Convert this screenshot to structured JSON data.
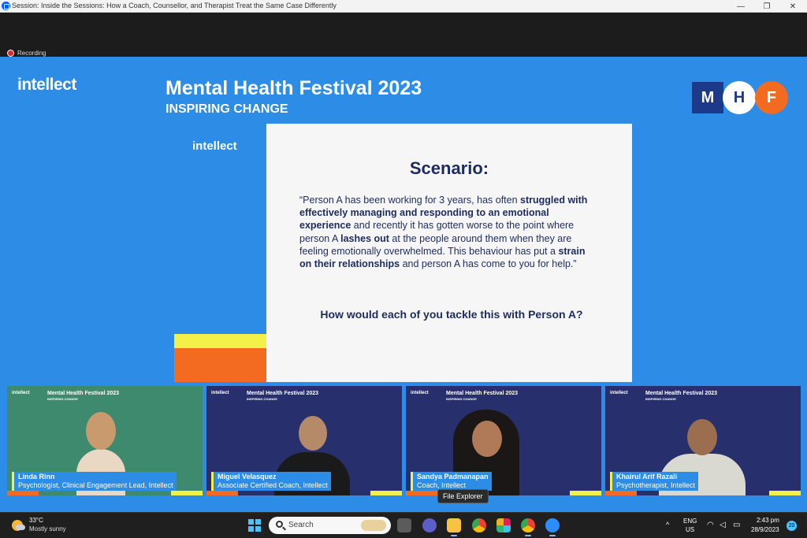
{
  "window": {
    "title": "Session: Inside the Sessions: How a Coach, Counsellor, and Therapist Treat the Same Case Differently",
    "minimize_glyph": "—",
    "restore_glyph": "❐",
    "close_glyph": "✕"
  },
  "recording": {
    "label": "Recording"
  },
  "header": {
    "logo": "intellect",
    "title": "Mental Health Festival 2023",
    "subtitle": "INSPIRING CHANGE",
    "badge": {
      "m": "M",
      "h": "H",
      "f": "F"
    }
  },
  "slide": {
    "logo": "intellect",
    "heading": "Scenario:",
    "body_parts": [
      "“Person A has been working for 3 years, has often ",
      "struggled with effectively managing and responding to an emotional experience",
      " and recently it has gotten worse to the point where person A ",
      "lashes out",
      " at the people around them when they are feeling emotionally overwhelmed. This behaviour has put a ",
      "strain on their relationships",
      " and person A has come to you for help.”"
    ],
    "question": "How would each of you tackle this with Person A?"
  },
  "participants": [
    {
      "name": "Linda Rinn",
      "role": "Psychologist, Clinical Engagement Lead, Intellect",
      "bg": "#3d8a6e"
    },
    {
      "name": "Miguel Velasquez",
      "role": "Associate Certified Coach, Intellect",
      "bg": "#27306d"
    },
    {
      "name": "Sandya Padmanapan",
      "role": "Coach, Intellect",
      "bg": "#27306d"
    },
    {
      "name": "Khairul Arif Razali",
      "role": "Psychotherapist, Intellect",
      "bg": "#27306d"
    }
  ],
  "tile_header": {
    "logo": "intellect",
    "title": "Mental Health Festival 2023",
    "subtitle": "INSPIRING CHANGE"
  },
  "tooltip": {
    "text": "File Explorer"
  },
  "taskbar": {
    "weather": {
      "temp": "33°C",
      "condition": "Mostly sunny"
    },
    "search_label": "Search",
    "apps": [
      "task-view",
      "teams",
      "file-explorer",
      "chrome",
      "slack",
      "chrome-profile",
      "zoom"
    ],
    "tray": {
      "chevron": "^",
      "lang_line1": "ENG",
      "lang_line2": "US",
      "time": "2:43 pm",
      "date": "28/9/2023",
      "notifications": "20"
    }
  },
  "colors": {
    "brand_blue": "#2c8ce6",
    "navy": "#1d2c5e",
    "orange": "#f26b21",
    "yellow": "#f4f04a"
  }
}
